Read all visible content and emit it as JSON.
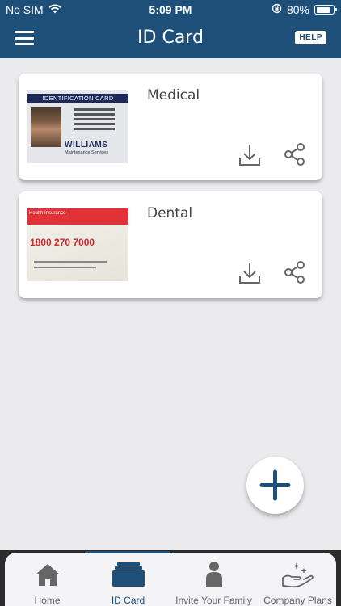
{
  "status_bar": {
    "carrier": "No SIM",
    "time": "5:09 PM",
    "battery": "80%",
    "battery_level": 0.8
  },
  "header": {
    "title": "ID Card",
    "help_label": "HELP"
  },
  "cards": [
    {
      "label": "Medical",
      "image": {
        "header": "IDENTIFICATION CARD",
        "brand": "WILLIAMS",
        "subtitle": "Maintenance Services"
      }
    },
    {
      "label": "Dental",
      "image": {
        "header": "Health Insurance",
        "phone": "1800 270 7000"
      }
    }
  ],
  "tabs": [
    {
      "label": "Home",
      "icon": "home-icon",
      "active": false
    },
    {
      "label": "ID Card",
      "icon": "id-card-icon",
      "active": true
    },
    {
      "label": "Invite Your Family",
      "icon": "person-icon",
      "active": false
    },
    {
      "label": "Company Plans",
      "icon": "hand-sparkle-icon",
      "active": false
    }
  ],
  "colors": {
    "primary": "#1d4f78",
    "background": "#ebebed",
    "icon_gray": "#666666"
  }
}
